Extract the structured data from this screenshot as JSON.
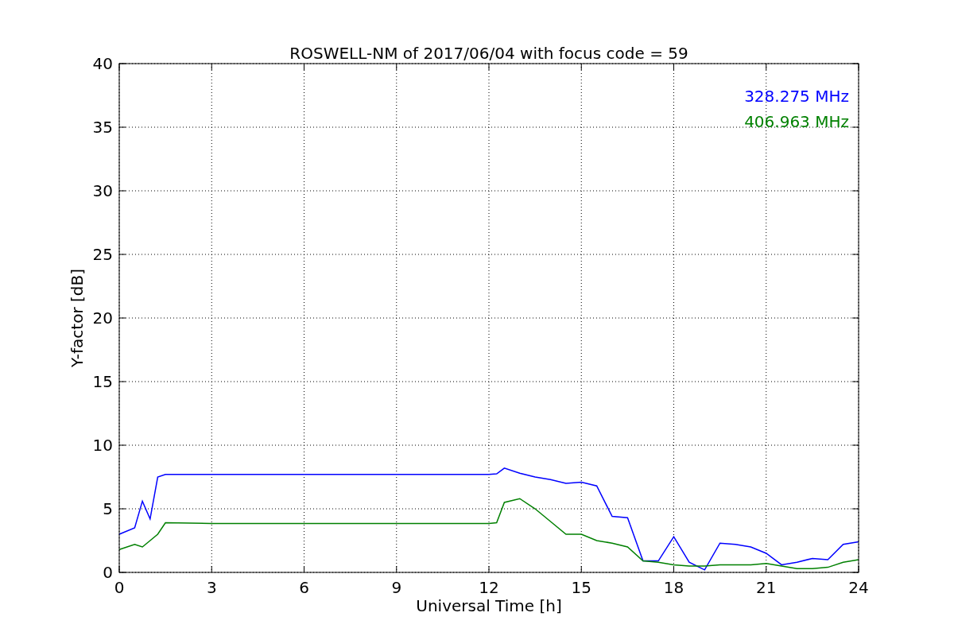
{
  "chart": {
    "chart_data": {
      "type": "line",
      "title": "ROSWELL-NM of 2017/06/04 with focus code = 59",
      "xlabel": "Universal Time [h]",
      "ylabel": "Y-factor [dB]",
      "x": [
        0,
        0.5,
        0.75,
        1,
        1.25,
        1.5,
        3,
        6,
        9,
        12,
        12.25,
        12.5,
        13,
        13.5,
        14,
        14.5,
        15,
        15.5,
        16,
        16.5,
        17,
        17.5,
        18,
        18.5,
        19,
        19.5,
        20,
        20.5,
        21,
        21.5,
        22,
        22.5,
        23,
        23.5,
        24
      ],
      "series": [
        {
          "name": "328.275 MHz",
          "color": "#0000ff",
          "values": [
            3.0,
            3.5,
            5.6,
            4.2,
            7.5,
            7.7,
            7.7,
            7.7,
            7.7,
            7.7,
            7.75,
            8.2,
            7.8,
            7.5,
            7.3,
            7.0,
            7.1,
            6.8,
            4.4,
            4.3,
            0.9,
            0.9,
            2.8,
            0.8,
            0.2,
            2.3,
            2.2,
            2.0,
            1.5,
            0.6,
            0.8,
            1.1,
            1.0,
            2.2,
            2.4
          ]
        },
        {
          "name": "406.963 MHz",
          "color": "#008000",
          "values": [
            1.8,
            2.2,
            2.0,
            2.5,
            3.0,
            3.9,
            3.85,
            3.85,
            3.85,
            3.85,
            3.9,
            5.5,
            5.8,
            5.0,
            4.0,
            3.0,
            3.0,
            2.5,
            2.3,
            2.0,
            0.9,
            0.8,
            0.6,
            0.5,
            0.5,
            0.6,
            0.6,
            0.6,
            0.7,
            0.5,
            0.3,
            0.3,
            0.4,
            0.8,
            1.0
          ]
        }
      ],
      "xlim": [
        0,
        24
      ],
      "ylim": [
        0,
        40
      ],
      "xticks": [
        0,
        3,
        6,
        9,
        12,
        15,
        18,
        21,
        24
      ],
      "yticks": [
        0,
        5,
        10,
        15,
        20,
        25,
        30,
        35,
        40
      ],
      "grid": true
    }
  }
}
